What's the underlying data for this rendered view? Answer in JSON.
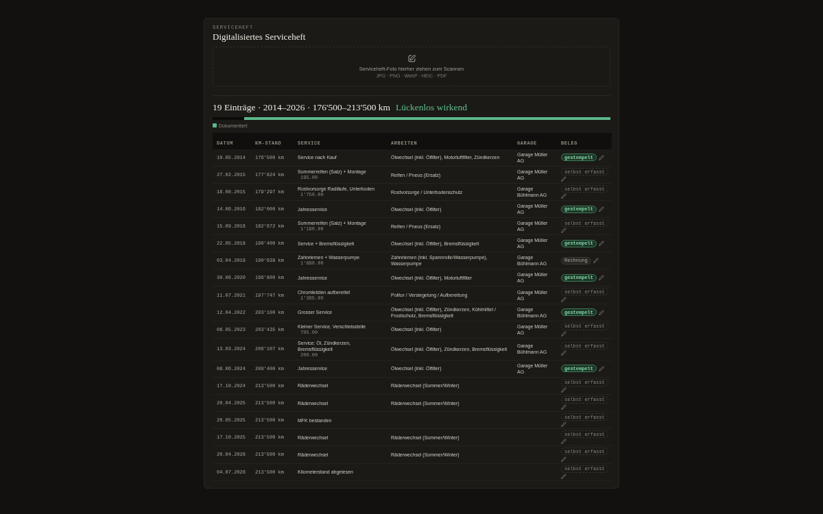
{
  "header": {
    "eyebrow": "SERVICEHEFT",
    "title": "Digitalisiertes Serviceheft"
  },
  "dropzone": {
    "prompt": "Serviceheft-Foto hierher ziehen zum Scannen",
    "formats": "JPG · PNG · WebP · HEIC · PDF"
  },
  "summary": {
    "title": "19 Einträge · 2014–2026 · 176'500–213'500 km",
    "verdict": "Lückenlos wirkend"
  },
  "coverage": {
    "level": 0.92
  },
  "legend": [
    {
      "label": "Dokumentiert",
      "color": "#5cb88a"
    }
  ],
  "table": {
    "columns": [
      "DATUM",
      "KM-STAND",
      "SERVICE",
      "ARBEITEN",
      "GARAGE",
      "BELEG"
    ],
    "rows": [
      {
        "date": "10.05.2014",
        "km": "176'500 km",
        "service": "Service nach Kauf",
        "work": "Ölwechsel (inkl. Ölfilter), Motorluftfilter, Zündkerzen",
        "garage": "Garage Müller AG",
        "receipt": {
          "kind": "stamped",
          "label": "gestempelt"
        }
      },
      {
        "date": "27.02.2015",
        "km": "177'824 km",
        "service": "Sommerreifen (Satz) + Montage",
        "price": "195.00",
        "work": "Reifen / Pneus (Ersatz)",
        "garage": "Garage Müller AG",
        "receipt": {
          "kind": "self",
          "label": "selbst erfasst"
        }
      },
      {
        "date": "18.08.2015",
        "km": "179'297 km",
        "service": "Rostvorsorge Radläufe, Unterboden",
        "price": "1'750.00",
        "work": "Rostvorsorge / Unterbodenschutz",
        "garage": "Garage Bühlmann AG",
        "receipt": {
          "kind": "self",
          "label": "selbst erfasst"
        }
      },
      {
        "date": "14.06.2016",
        "km": "182'000 km",
        "service": "Jahresservice",
        "work": "Ölwechsel (inkl. Ölfilter)",
        "garage": "Garage Müller AG",
        "receipt": {
          "kind": "stamped",
          "label": "gestempelt"
        }
      },
      {
        "date": "15.09.2016",
        "km": "182'672 km",
        "service": "Sommerreifen (Satz) + Montage",
        "price": "1'190.00",
        "work": "Reifen / Pneus (Ersatz)",
        "garage": "Garage Müller AG",
        "receipt": {
          "kind": "self",
          "label": "selbst erfasst"
        }
      },
      {
        "date": "22.05.2018",
        "km": "190'400 km",
        "service": "Service + Bremsflüssigkeit",
        "work": "Ölwechsel (inkl. Ölfilter), Bremsflüssigkeit",
        "garage": "Garage Müller AG",
        "receipt": {
          "kind": "stamped",
          "label": "gestempelt"
        }
      },
      {
        "date": "03.04.2019",
        "km": "190'638 km",
        "service": "Zahnriemen + Wasserpumpe",
        "price": "1'880.00",
        "work": "Zahnriemen (inkl. Spannrolle/Wasserpumpe), Wasserpumpe",
        "garage": "Garage Bühlmann AG",
        "receipt": {
          "kind": "invoice",
          "label": "Rechnung"
        }
      },
      {
        "date": "30.06.2020",
        "km": "196'800 km",
        "service": "Jahresservice",
        "work": "Ölwechsel (inkl. Ölfilter), Motorluftfilter",
        "garage": "Garage Müller AG",
        "receipt": {
          "kind": "stamped",
          "label": "gestempelt"
        }
      },
      {
        "date": "11.07.2021",
        "km": "197'747 km",
        "service": "Chromleisten aufbereitet",
        "price": "1'365.00",
        "work": "Politur / Versiegelung / Aufbereitung",
        "garage": "Garage Müller AG",
        "receipt": {
          "kind": "self",
          "label": "selbst erfasst"
        }
      },
      {
        "date": "12.04.2022",
        "km": "203'100 km",
        "service": "Grosser Service",
        "work": "Ölwechsel (inkl. Ölfilter), Zündkerzen, Kühlmittel / Frostschutz, Bremsflüssigkeit",
        "garage": "Garage Bühlmann AG",
        "receipt": {
          "kind": "stamped",
          "label": "gestempelt"
        }
      },
      {
        "date": "06.05.2023",
        "km": "203'435 km",
        "service": "Kleiner Service, Verschleissteile",
        "price": "705.00",
        "work": "Ölwechsel (inkl. Ölfilter)",
        "garage": "Garage Müller AG",
        "receipt": {
          "kind": "self",
          "label": "selbst erfasst"
        }
      },
      {
        "date": "13.03.2024",
        "km": "206'107 km",
        "service": "Service: Öl, Zündkerzen, Bremsflüssigkeit",
        "price": "200.00",
        "work": "Ölwechsel (inkl. Ölfilter), Zündkerzen, Bremsflüssigkeit",
        "garage": "Garage Bühlmann AG",
        "receipt": {
          "kind": "self",
          "label": "selbst erfasst"
        }
      },
      {
        "date": "08.06.2024",
        "km": "209'400 km",
        "service": "Jahresservice",
        "work": "Ölwechsel (inkl. Ölfilter)",
        "garage": "Garage Müller AG",
        "receipt": {
          "kind": "stamped",
          "label": "gestempelt"
        }
      },
      {
        "date": "17.10.2024",
        "km": "213'500 km",
        "service": "Räderwechsel",
        "work": "Räderwechsel (Sommer/Winter)",
        "receipt": {
          "kind": "self",
          "label": "selbst erfasst"
        }
      },
      {
        "date": "20.04.2025",
        "km": "213'500 km",
        "service": "Räderwechsel",
        "work": "Räderwechsel (Sommer/Winter)",
        "receipt": {
          "kind": "self",
          "label": "selbst erfasst"
        }
      },
      {
        "date": "20.05.2025",
        "km": "213'500 km",
        "service": "MFK bestanden",
        "receipt": {
          "kind": "self",
          "label": "selbst erfasst"
        }
      },
      {
        "date": "17.10.2025",
        "km": "213'500 km",
        "service": "Räderwechsel",
        "work": "Räderwechsel (Sommer/Winter)",
        "receipt": {
          "kind": "self",
          "label": "selbst erfasst"
        }
      },
      {
        "date": "20.04.2026",
        "km": "213'500 km",
        "service": "Räderwechsel",
        "work": "Räderwechsel (Sommer/Winter)",
        "receipt": {
          "kind": "self",
          "label": "selbst erfasst"
        }
      },
      {
        "date": "04.07.2026",
        "km": "213'500 km",
        "service": "Kilometerstand abgelesen",
        "receipt": {
          "kind": "self",
          "label": "selbst erfasst"
        }
      }
    ]
  }
}
